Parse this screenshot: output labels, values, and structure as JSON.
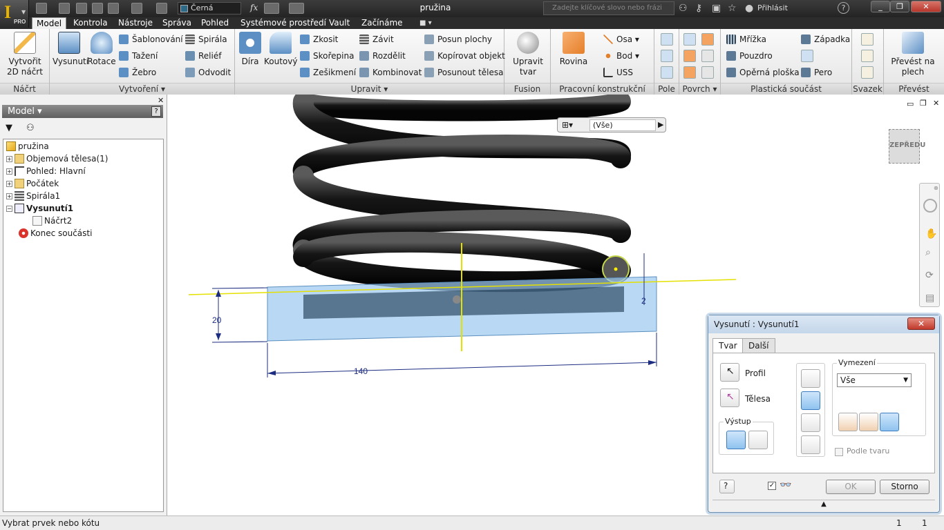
{
  "titlebar": {
    "doc_title": "pružina",
    "color_value": "Černá",
    "search_placeholder": "Zadejte klíčové slovo nebo frázi",
    "login": "Přihlásit",
    "app_logo": "I",
    "app_edition": "PRO"
  },
  "tabs": [
    "Model",
    "Kontrola",
    "Nástroje",
    "Správa",
    "Pohled",
    "Systémové prostředí",
    "Vault",
    "Začínáme"
  ],
  "ribbon": {
    "nacrt": {
      "create_sketch": "Vytvořit\n2D náčrt",
      "label": "Náčrt"
    },
    "vytvoreni": {
      "extrude": "Vysunutí",
      "revolve": "Rotace",
      "loft": "Šablonování",
      "sweep": "Tažení",
      "rib": "Žebro",
      "coil": "Spirála",
      "emboss": "Reliéf",
      "derive": "Odvodit",
      "label": "Vytvoření"
    },
    "upravit": {
      "hole": "Díra",
      "fillet": "Koutový",
      "chamfer": "Zkosit",
      "shell": "Skořepina",
      "draft": "Zešikmení",
      "thread": "Závit",
      "split": "Rozdělit",
      "combine": "Kombinovat",
      "move_face": "Posun plochy",
      "copy_object": "Kopírovat objekt",
      "move_bodies": "Posunout tělesa",
      "label": "Upravit"
    },
    "fusion": {
      "edit_form": "Upravit\ntvar",
      "label": "Fusion"
    },
    "work": {
      "plane": "Rovina",
      "axis": "Osa",
      "point": "Bod",
      "ucs": "USS",
      "label": "Pracovní konstrukční prvky"
    },
    "pole": {
      "label": "Pole"
    },
    "povrch": {
      "label": "Povrch"
    },
    "plastic": {
      "grill": "Mřížka",
      "boss": "Pouzdro",
      "rest": "Opěrná ploška",
      "snap": "Západka",
      "lip": "Pero",
      "label": "Plastická součást"
    },
    "svazek": {
      "label": "Svazek"
    },
    "prevest": {
      "convert": "Převést na\nplech",
      "label": "Převést"
    }
  },
  "browser": {
    "header": "Model",
    "tree": [
      {
        "label": "pružina",
        "level": 0
      },
      {
        "label": "Objemová tělesa(1)",
        "level": 1
      },
      {
        "label": "Pohled: Hlavní",
        "level": 1
      },
      {
        "label": "Počátek",
        "level": 1
      },
      {
        "label": "Spirála1",
        "level": 1
      },
      {
        "label": "Vysunutí1",
        "level": 1,
        "bold": true
      },
      {
        "label": "Náčrt2",
        "level": 2
      },
      {
        "label": "Konec součásti",
        "level": 1
      }
    ]
  },
  "canvas": {
    "filter": "(Vše)",
    "viewcube": "ZEPŘEDU",
    "dim_width": "140",
    "dim_height": "20",
    "dim_offset": "2"
  },
  "dialog": {
    "title": "Vysunutí : Vysunutí1",
    "tabs": [
      "Tvar",
      "Další"
    ],
    "profile": "Profil",
    "bodies": "Tělesa",
    "output": "Výstup",
    "extents_label": "Vymezení",
    "extents_value": "Vše",
    "match_shape": "Podle tvaru",
    "ok": "OK",
    "cancel": "Storno"
  },
  "status": {
    "message": "Vybrat prvek nebo kótu",
    "count1": "1",
    "count2": "1"
  }
}
